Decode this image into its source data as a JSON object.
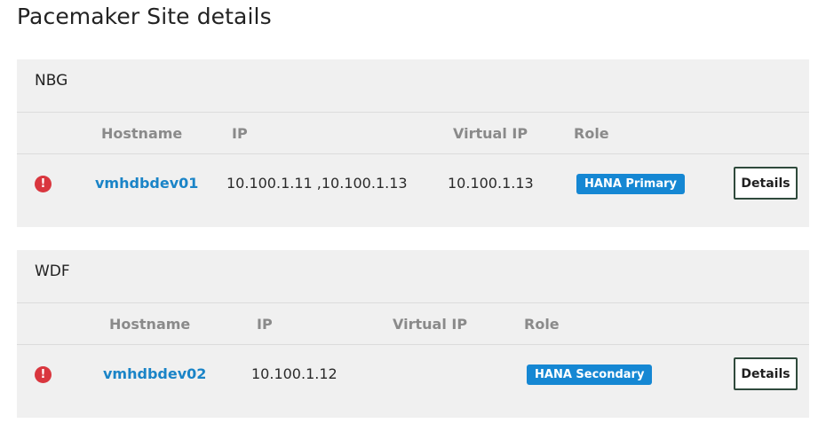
{
  "page": {
    "title": "Pacemaker Site details"
  },
  "columns": {
    "hostname": "Hostname",
    "ip": "IP",
    "virtual_ip": "Virtual IP",
    "role": "Role"
  },
  "sites": [
    {
      "name": "NBG",
      "node": {
        "status_icon": "error-icon",
        "hostname": "vmhdbdev01",
        "ip": "10.100.1.11 ,10.100.1.13",
        "virtual_ip": "10.100.1.13",
        "role": "HANA Primary",
        "details_label": "Details"
      }
    },
    {
      "name": "WDF",
      "node": {
        "status_icon": "error-icon",
        "hostname": "vmhdbdev02",
        "ip": "10.100.1.12",
        "virtual_ip": "",
        "role": "HANA Secondary",
        "details_label": "Details"
      }
    }
  ],
  "colors": {
    "accent": "#1a84c7",
    "badge": "#1587d3",
    "error": "#d9363e",
    "card_bg": "#f0f0f0"
  }
}
